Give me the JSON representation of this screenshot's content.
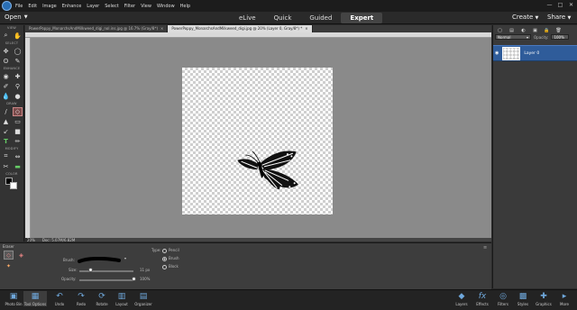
{
  "menubar": {
    "items": [
      "File",
      "Edit",
      "Image",
      "Enhance",
      "Layer",
      "Select",
      "Filter",
      "View",
      "Window",
      "Help"
    ],
    "window_buttons": [
      "—",
      "□",
      "✕"
    ]
  },
  "modebar": {
    "open_label": "Open",
    "tabs": [
      "eLive",
      "Quick",
      "Guided",
      "Expert"
    ],
    "active_tab": "Expert",
    "create_label": "Create",
    "share_label": "Share"
  },
  "toolbar": {
    "sections": {
      "view": "VIEW",
      "select": "SELECT",
      "enhance": "ENHANCE",
      "draw": "DRAW",
      "modify": "MODIFY",
      "color": "COLOR"
    }
  },
  "doc_tabs": [
    {
      "label": "PowerPoppy_MonarchsAndMilkweed_digi_nol.ins.jpg @ 16.7% (Gray/8*)",
      "close": "×"
    },
    {
      "label": "PowerPoppy_MonarchsAndMilkweed_digi.jpg @ 20% (Layer 0, Gray/8*) *",
      "close": "×"
    }
  ],
  "status": {
    "zoom": "20%",
    "doc": "Doc: 5.07M/6.82M"
  },
  "layers_panel": {
    "blend_mode": "Normal",
    "opacity_label": "Opacity:",
    "opacity_value": "100%",
    "layer_name": "Layer 0"
  },
  "tool_options": {
    "tool_name": "Eraser",
    "brush_label": "Brush:",
    "size_label": "Size:",
    "size_value": "11 px",
    "opacity_label": "Opacity:",
    "opacity_value": "100%",
    "type_label": "Type:",
    "type_options": [
      "Pencil",
      "Brush",
      "Block"
    ],
    "type_selected": "Brush",
    "size_level": 0.2,
    "opacity_level": 1.0
  },
  "taskbar": {
    "left": [
      {
        "label": "Photo Bin",
        "icon": "photo-bin-icon"
      },
      {
        "label": "Tool Options",
        "icon": "tool-options-icon"
      },
      {
        "label": "Undo",
        "icon": "undo-icon"
      },
      {
        "label": "Redo",
        "icon": "redo-icon"
      },
      {
        "label": "Rotate",
        "icon": "rotate-icon"
      },
      {
        "label": "Layout",
        "icon": "layout-icon"
      },
      {
        "label": "Organizer",
        "icon": "organizer-icon"
      }
    ],
    "right": [
      {
        "label": "Layers",
        "icon": "layers-icon"
      },
      {
        "label": "Effects",
        "icon": "effects-icon"
      },
      {
        "label": "Filters",
        "icon": "filters-icon"
      },
      {
        "label": "Styles",
        "icon": "styles-icon"
      },
      {
        "label": "Graphics",
        "icon": "graphics-icon"
      },
      {
        "label": "More",
        "icon": "more-icon"
      }
    ]
  },
  "colors": {
    "accent": "#2f5c9a",
    "canvas_bg": "#8a8a8a"
  }
}
